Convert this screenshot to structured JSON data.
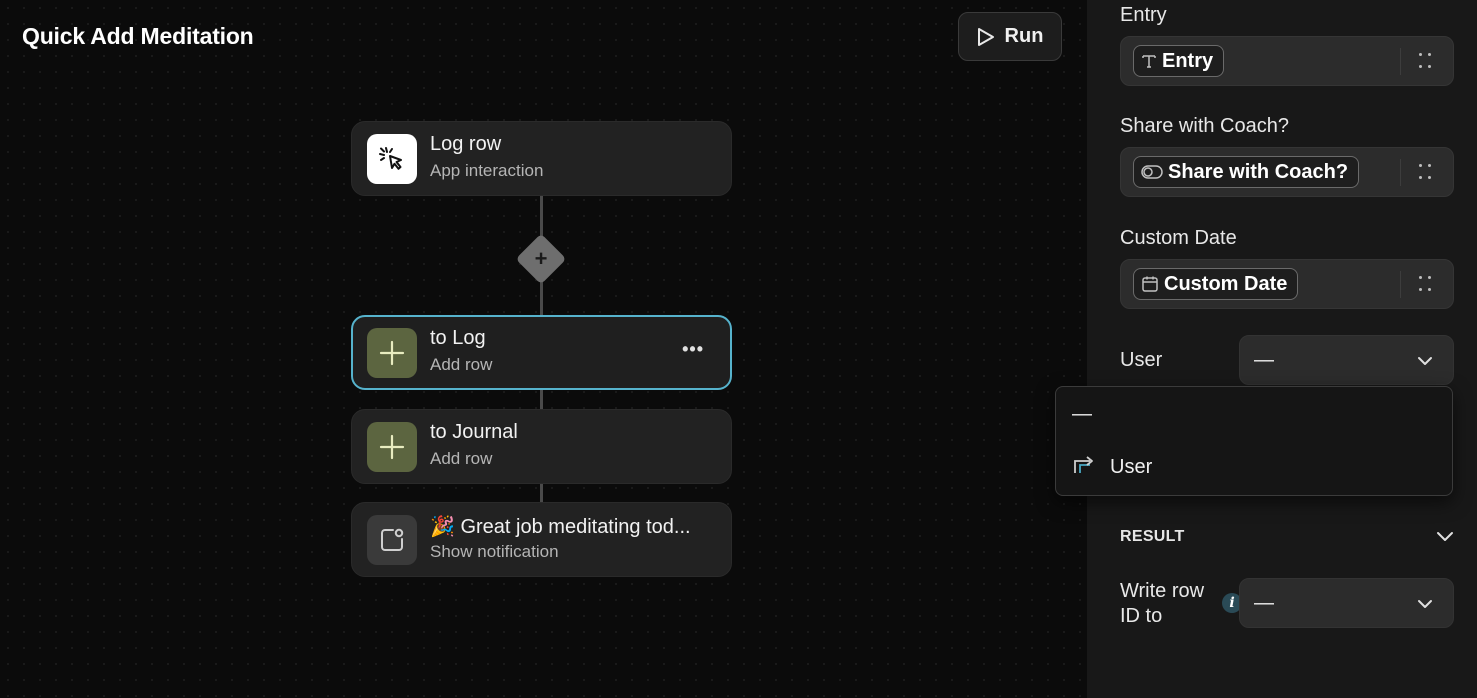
{
  "workflow": {
    "title": "Quick Add Meditation",
    "run_label": "Run"
  },
  "nodes": [
    {
      "title": "Log row",
      "subtitle": "App interaction",
      "icon": "cursor-click-icon"
    },
    {
      "title": "to Log",
      "subtitle": "Add row",
      "icon": "plus-icon",
      "selected": true,
      "more": "•••"
    },
    {
      "title": "to Journal",
      "subtitle": "Add row",
      "icon": "plus-icon"
    },
    {
      "title": "🎉 Great job meditating tod...",
      "subtitle": "Show notification",
      "icon": "notification-icon"
    }
  ],
  "add_step": {
    "icon": "plus-icon",
    "symbol": "+"
  },
  "panel": {
    "fields": [
      {
        "label": "Entry",
        "chip": "Entry",
        "chip_icon": "text-icon"
      },
      {
        "label": "Share with Coach?",
        "chip": "Share with Coach?",
        "chip_icon": "toggle-icon"
      },
      {
        "label": "Custom Date",
        "chip": "Custom Date",
        "chip_icon": "calendar-icon"
      }
    ],
    "user": {
      "label": "User",
      "value": "—"
    },
    "dropdown": {
      "options": [
        {
          "label": "—"
        },
        {
          "label": "User",
          "icon": "column-arrow-icon"
        }
      ]
    },
    "result": {
      "section_title": "RESULT",
      "write_row_label": "Write row ID to",
      "write_row_value": "—",
      "info": "i"
    }
  },
  "colors": {
    "accent": "#56b3cd",
    "add_row_icon_bg": "#5c6540",
    "add_row_icon_fg": "#e8ecc0"
  }
}
